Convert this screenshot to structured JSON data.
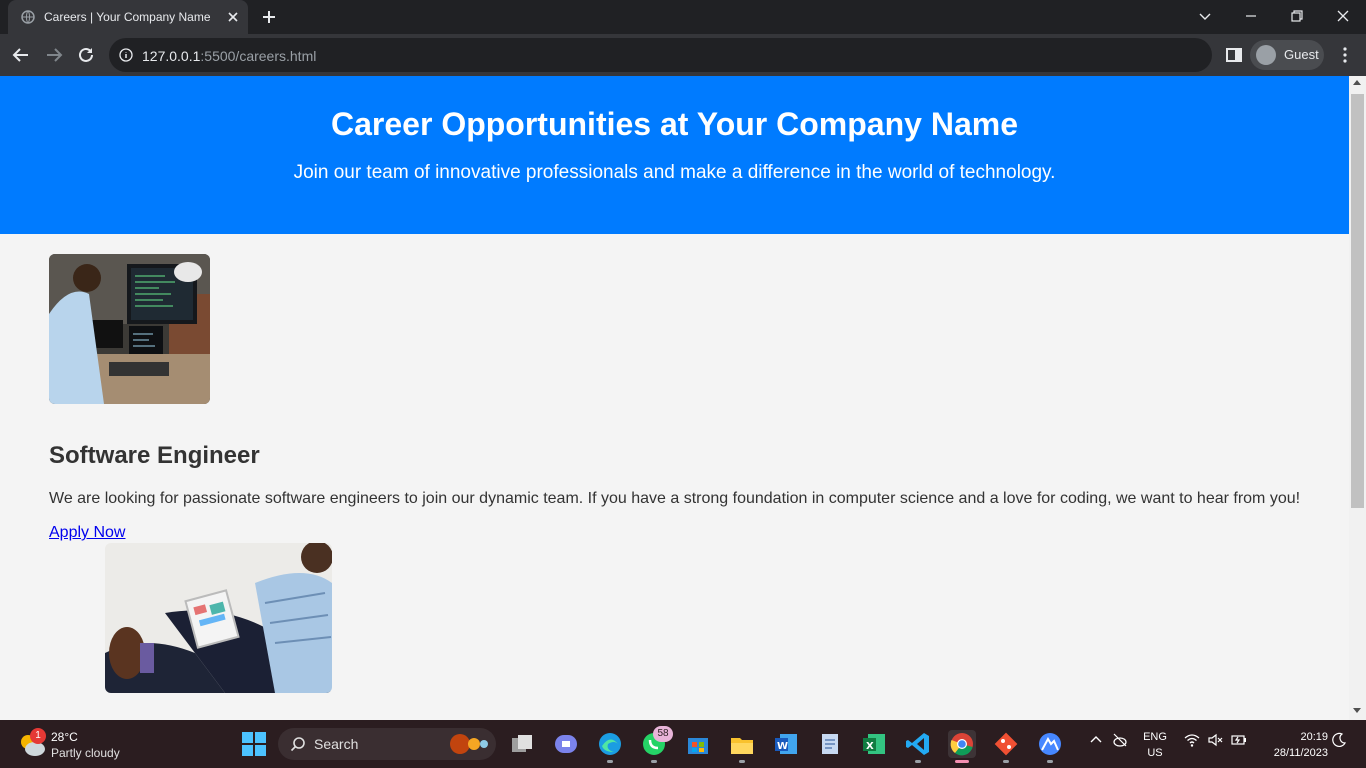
{
  "browser": {
    "tab_title": "Careers | Your Company Name",
    "url_host": "127.0.0.1",
    "url_path": ":5500/careers.html",
    "profile_label": "Guest"
  },
  "page": {
    "hero": {
      "title": "Career Opportunities at Your Company Name",
      "subtitle": "Join our team of innovative professionals and make a difference in the world of technology."
    },
    "job": {
      "title": "Software Engineer",
      "description": "We are looking for passionate software engineers to join our dynamic team. If you have a strong foundation in computer science and a love for coding, we want to hear from you!",
      "apply_label": "Apply Now"
    }
  },
  "taskbar": {
    "weather_badge": "1",
    "weather_temp": "28°C",
    "weather_condition": "Partly cloudy",
    "search_label": "Search",
    "whatsapp_badge": "58",
    "lang_line1": "ENG",
    "lang_line2": "US",
    "time": "20:19",
    "date": "28/11/2023"
  },
  "colors": {
    "hero_bg": "#007bff",
    "page_bg": "#f4f4f4",
    "link": "#0000ee",
    "chrome_dark": "#202124",
    "chrome_toolbar": "#35363a",
    "taskbar_bg": "#2b1d20"
  }
}
